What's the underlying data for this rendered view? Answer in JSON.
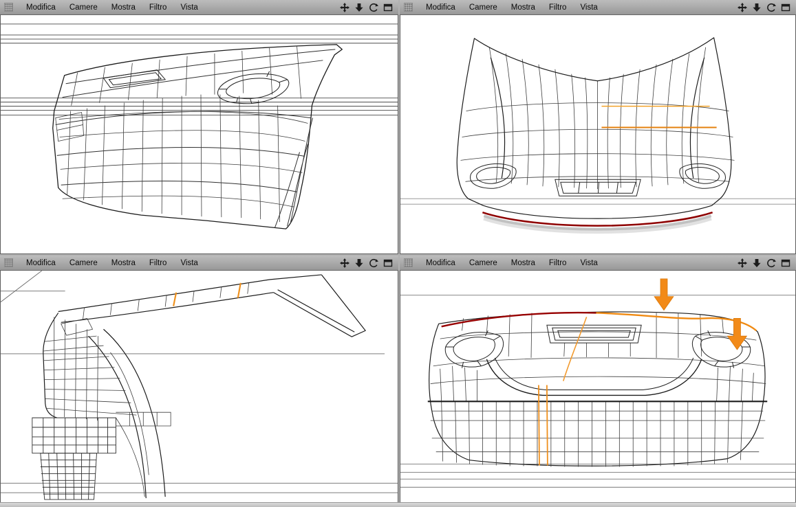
{
  "viewport_menu": {
    "items": [
      "Modifica",
      "Camere",
      "Mostra",
      "Filtro",
      "Vista"
    ]
  },
  "viewport_nav_icons": [
    {
      "name": "pan-camera-icon"
    },
    {
      "name": "zoom-camera-icon"
    },
    {
      "name": "rotate-camera-icon"
    },
    {
      "name": "viewport-toggle-icon"
    }
  ],
  "viewports": [
    {
      "name": "perspective-view"
    },
    {
      "name": "front-view"
    },
    {
      "name": "side-view"
    },
    {
      "name": "bottom-front-view"
    }
  ],
  "colors": {
    "menu_bar_top": "#bcbcbc",
    "menu_bar_bottom": "#989898",
    "wireframe": "#2b2b2b",
    "selection_orange": "#f0921e",
    "selection_orange_dark": "#e07c0a",
    "selection_red": "#950000",
    "canvas_background": "#ffffff"
  }
}
